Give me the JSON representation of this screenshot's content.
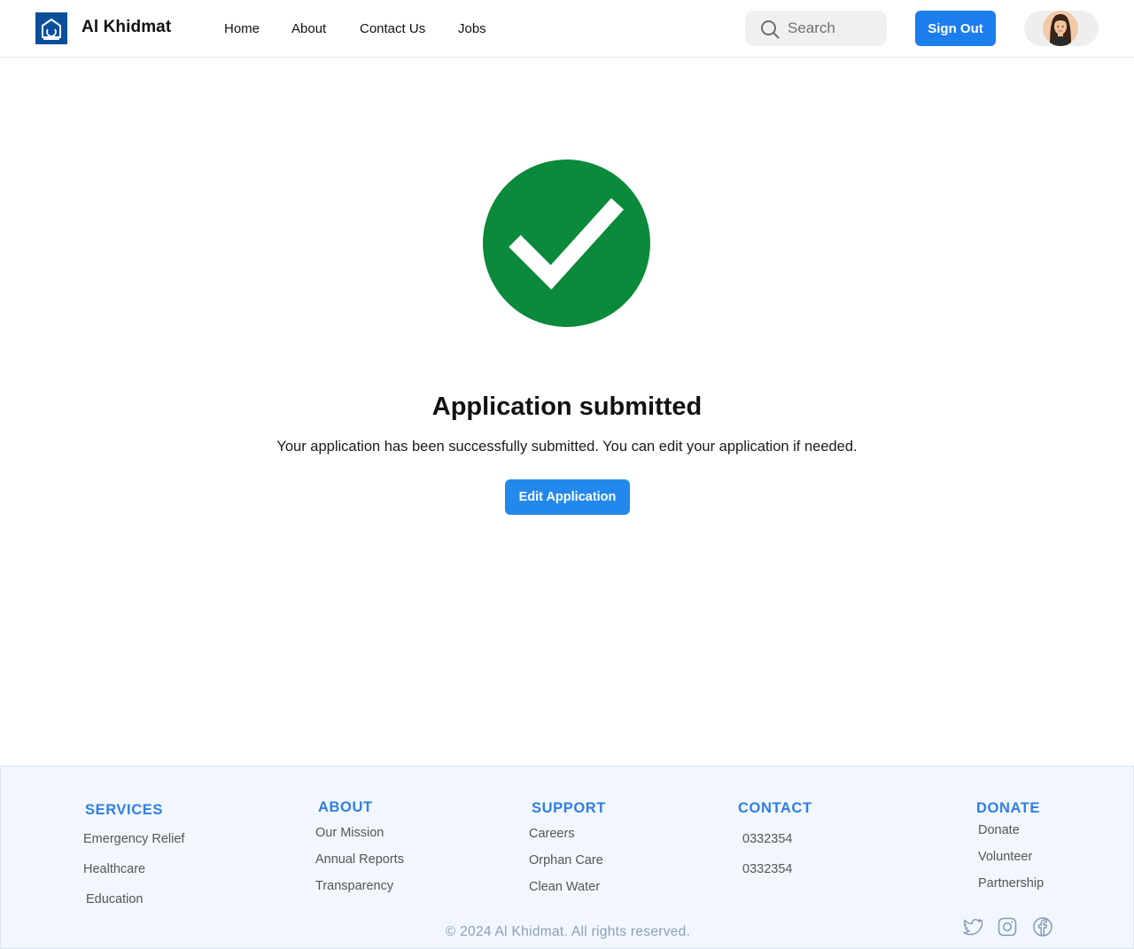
{
  "header": {
    "brand": "Al Khidmat",
    "logo_icon": "alkhidmat-logo-icon",
    "nav": [
      {
        "label": "Home"
      },
      {
        "label": "About"
      },
      {
        "label": "Contact Us"
      },
      {
        "label": "Jobs"
      }
    ],
    "search": {
      "placeholder": "Search",
      "icon": "search-icon"
    },
    "signout_label": "Sign Out",
    "avatar_icon": "user-avatar"
  },
  "main": {
    "status_icon": "check-circle-icon",
    "status_color": "#0a8a3a",
    "title": "Application submitted",
    "message": "Your application has been successfully submitted. You can edit your application if needed.",
    "edit_button_label": "Edit Application"
  },
  "footer": {
    "columns": [
      {
        "heading": "SERVICES",
        "links": [
          "Emergency Relief",
          "Healthcare",
          "Education"
        ]
      },
      {
        "heading": "ABOUT",
        "links": [
          "Our Mission",
          "Annual Reports",
          "Transparency"
        ]
      },
      {
        "heading": "SUPPORT",
        "links": [
          "Careers",
          "Orphan Care",
          "Clean Water"
        ]
      },
      {
        "heading": "CONTACT",
        "links": [
          "0332354",
          "0332354"
        ]
      },
      {
        "heading": "DONATE",
        "links": [
          "Donate",
          "Volunteer",
          "Partnership"
        ]
      }
    ],
    "copyright": "© 2024 Al Khidmat. All rights reserved.",
    "social_icons": [
      "twitter-icon",
      "instagram-icon",
      "facebook-icon"
    ]
  },
  "colors": {
    "primary": "#1c7ded",
    "success": "#0a8a3a",
    "footer_heading": "#2f7ee6",
    "footer_bg": "#f2f7fd"
  }
}
